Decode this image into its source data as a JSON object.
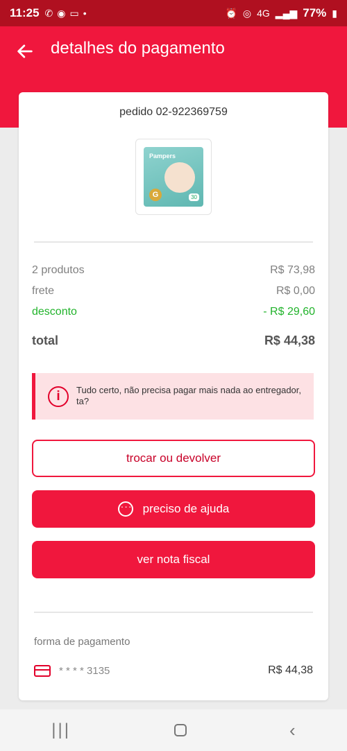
{
  "status_bar": {
    "time": "11:25",
    "battery": "77%",
    "network": "4G",
    "icons": [
      "whatsapp-icon",
      "app-icon",
      "laptop-icon",
      "dot-icon",
      "alarm-icon",
      "hotspot-icon",
      "signal-icon",
      "battery-icon"
    ]
  },
  "header": {
    "title": "detalhes do pagamento",
    "back_icon": "arrow-left-icon"
  },
  "order": {
    "label": "pedido 02-922369759",
    "product_image": {
      "brand": "Pampers",
      "size": "G",
      "count": "30"
    }
  },
  "summary": {
    "products_label": "2 produtos",
    "products_value": "R$ 73,98",
    "shipping_label": "frete",
    "shipping_value": "R$ 0,00",
    "discount_label": "desconto",
    "discount_value": "- R$ 29,60",
    "total_label": "total",
    "total_value": "R$ 44,38"
  },
  "alert": {
    "message": "Tudo certo, não precisa pagar mais nada ao entregador, ta?"
  },
  "actions": {
    "exchange_label": "trocar ou devolver",
    "help_label": "preciso de ajuda",
    "invoice_label": "ver nota fiscal"
  },
  "payment": {
    "label": "forma de pagamento",
    "card_number": "* * * * 3135",
    "amount": "R$ 44,38"
  },
  "colors": {
    "brand": "#f0173d",
    "status_bar": "#b01020",
    "discount": "#21b32b",
    "alert_bg": "#fde1e4"
  }
}
